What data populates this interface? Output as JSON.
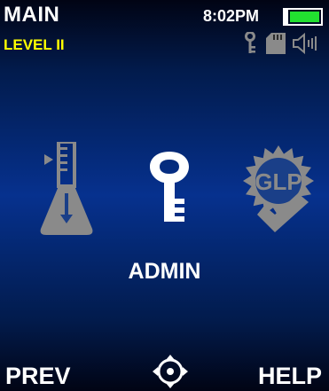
{
  "header": {
    "title": "MAIN",
    "level": "LEVEL II",
    "time": "8:02PM",
    "battery_level": 1.0,
    "status_icons": [
      "key-icon",
      "sd-card-icon",
      "speaker-icon"
    ]
  },
  "menu": {
    "items": [
      {
        "icon": "flask-icon",
        "selected": false
      },
      {
        "icon": "key-icon",
        "selected": true
      },
      {
        "icon": "glp-badge-icon",
        "label": "GLP",
        "selected": false
      }
    ],
    "selected_label": "ADMIN"
  },
  "softkeys": {
    "left": "PREV",
    "center_icon": "navigation-pad-icon",
    "right": "HELP"
  },
  "colors": {
    "background": "#06318e",
    "text": "#ffffff",
    "level_text": "#ffff00",
    "battery": "#22e030",
    "inactive_icon": "#8a8a8a"
  }
}
